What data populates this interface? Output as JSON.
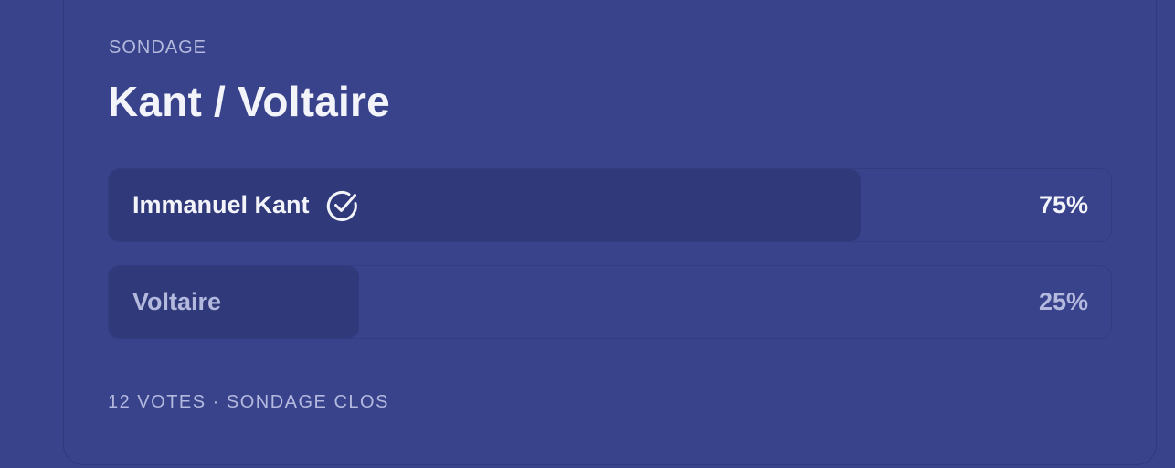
{
  "poll": {
    "eyebrow": "SONDAGE",
    "title": "Kant / Voltaire",
    "options": [
      {
        "label": "Immanuel Kant",
        "percent_label": "75%",
        "share": 0.75,
        "selected": true,
        "icon": "check-circle-icon"
      },
      {
        "label": "Voltaire",
        "percent_label": "25%",
        "share": 0.25,
        "selected": false
      }
    ],
    "footer": "12 VOTES · SONDAGE CLOS"
  },
  "colors": {
    "background": "#38438c",
    "bar_fill": "#30397a",
    "text_primary": "#f3f3fa",
    "text_muted": "#b4b9de"
  }
}
